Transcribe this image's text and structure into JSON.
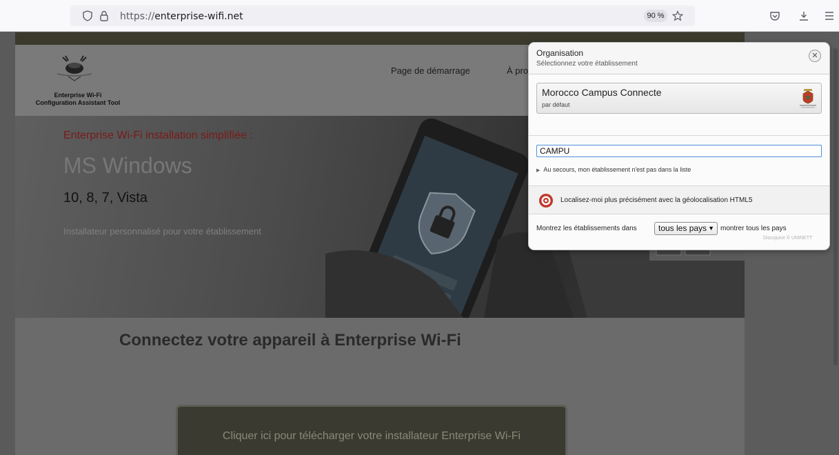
{
  "browser": {
    "url_scheme": "https://",
    "url_host": "enterprise-wifi.net",
    "zoom": "90 %"
  },
  "site": {
    "logo_line1": "Enterprise Wi-Fi",
    "logo_line2": "Configuration Assistant Tool",
    "nav": [
      "Page de démarrage",
      "À pro"
    ],
    "hero_title": "Enterprise Wi-Fi installation simplifiée :",
    "hero_os": "MS Windows",
    "hero_versions": "10, 8, 7, Vista",
    "hero_subtitle": "Installateur personnalisé pour votre établissement",
    "connect_title": "Connectez votre appareil à Enterprise Wi-Fi",
    "download_label": "Cliquer ici pour télécharger votre installateur Enterprise Wi-Fi"
  },
  "dialog": {
    "title": "Organisation",
    "subtitle": "Sélectionnez votre établissement",
    "org_name": "Morocco Campus Connecte",
    "org_default": "par défaut",
    "search_value": "CAMPU",
    "help_link": "Au secours, mon établissement n'est pas dans la liste",
    "geo_text": "Localisez-moi plus précisément avec la géolocalisation HTML5",
    "show_label": "Montrez les établissements dans",
    "country_selected": "tous les pays",
    "show_all": "montrer tous les pays",
    "credit": "Discojuice © UNINETT"
  }
}
